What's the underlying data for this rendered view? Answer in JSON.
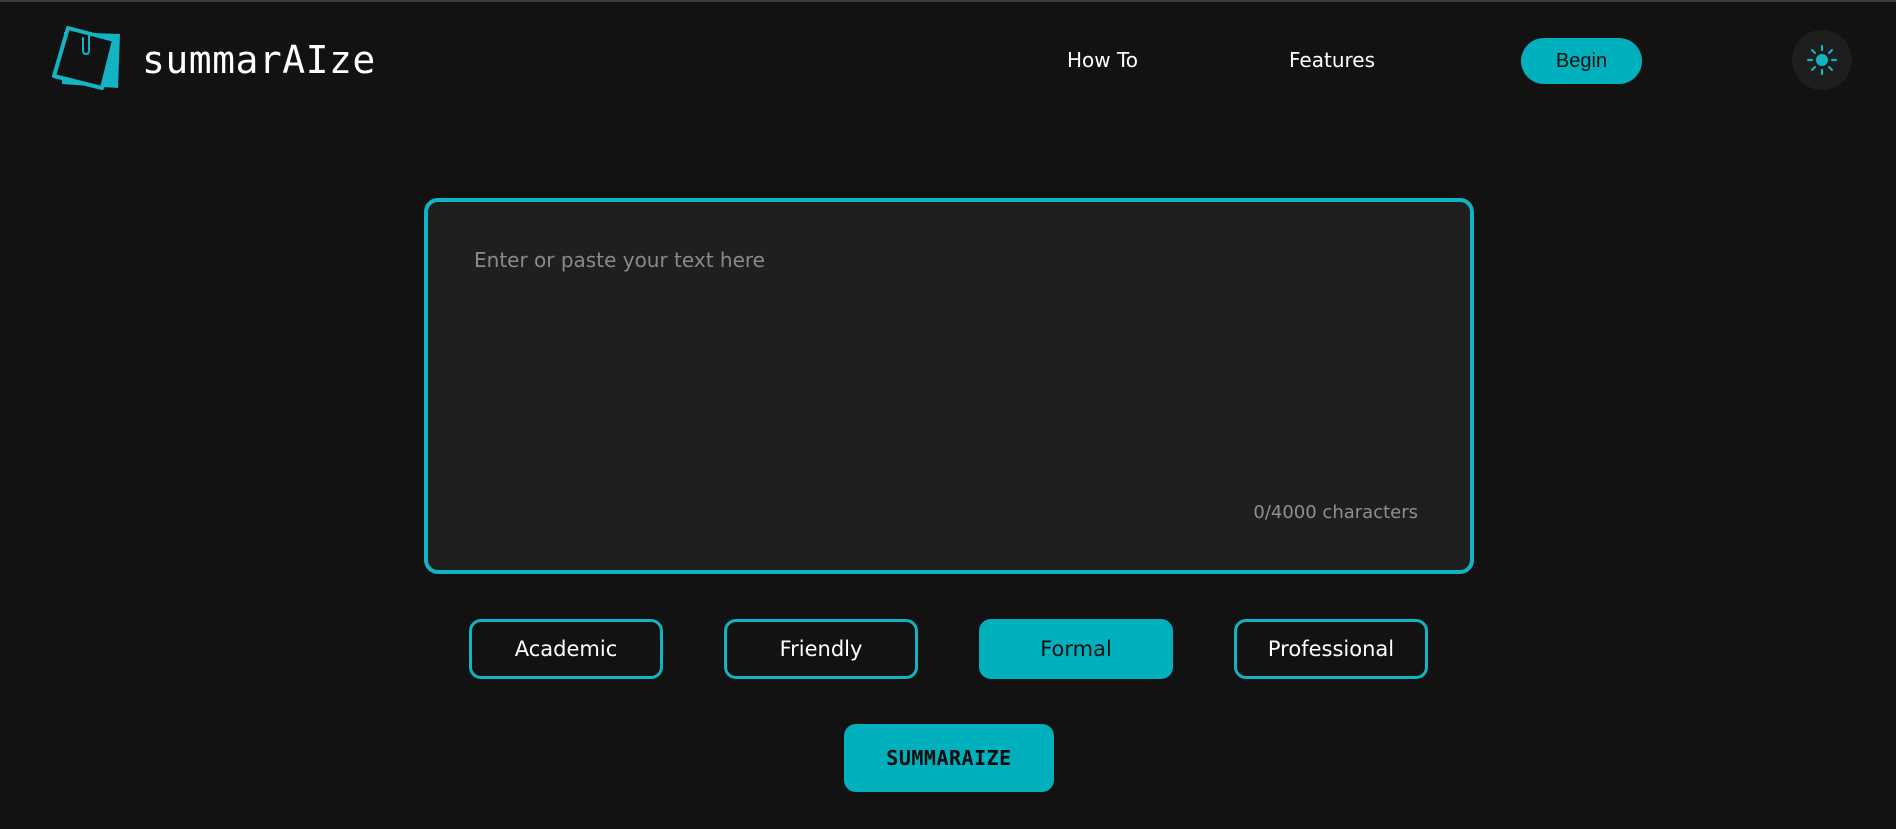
{
  "brand": {
    "name": "summarAIze",
    "logo_icon": "sticky-note-paperclip-icon",
    "accent_color": "#00b0bd"
  },
  "nav": {
    "items": [
      {
        "label": "How To"
      },
      {
        "label": "Features"
      }
    ],
    "cta_label": "Begin",
    "theme_toggle_icon": "sun-icon"
  },
  "editor": {
    "placeholder": "Enter or paste your text here",
    "value": "",
    "char_count": "0/4000 characters"
  },
  "tones": {
    "selected": "Formal",
    "options": [
      {
        "label": "Academic"
      },
      {
        "label": "Friendly"
      },
      {
        "label": "Formal"
      },
      {
        "label": "Professional"
      }
    ]
  },
  "actions": {
    "summarize_label": "SUMMARAIZE"
  }
}
